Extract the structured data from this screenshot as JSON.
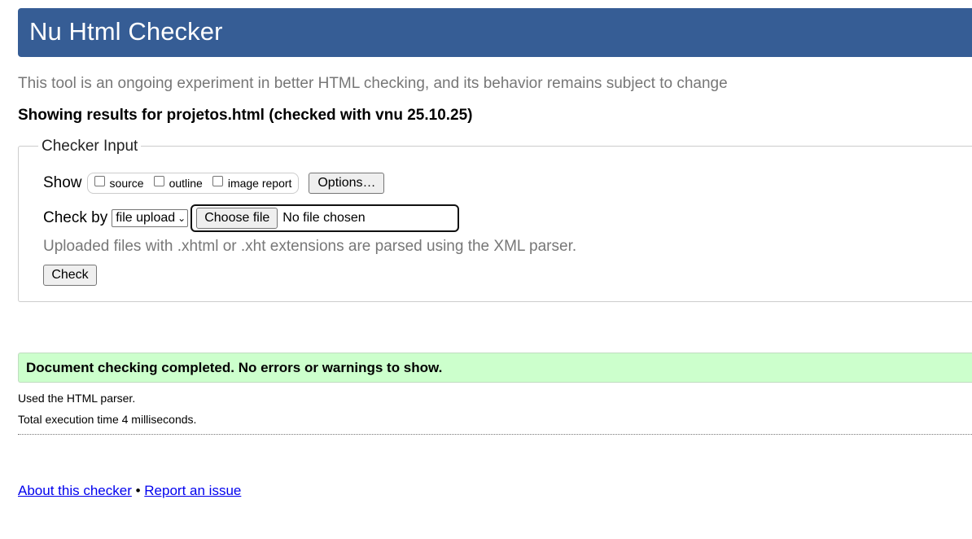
{
  "header": {
    "title": "Nu Html Checker"
  },
  "subtitle": "This tool is an ongoing experiment in better HTML checking, and its behavior remains subject to change",
  "results_heading": "Showing results for projetos.html (checked with vnu 25.10.25)",
  "checker_input": {
    "legend": "Checker Input",
    "show": {
      "label": "Show",
      "options": [
        {
          "label": "source",
          "checked": false
        },
        {
          "label": "outline",
          "checked": false
        },
        {
          "label": "image report",
          "checked": false
        }
      ],
      "options_button": "Options…"
    },
    "check_by": {
      "label": "Check by",
      "selected": "file upload",
      "choose_file_label": "Choose file",
      "file_status": "No file chosen"
    },
    "note": "Uploaded files with .xhtml or .xht extensions are parsed using the XML parser.",
    "check_button": "Check"
  },
  "result": {
    "message": "Document checking completed. No errors or warnings to show."
  },
  "details": {
    "parser": "Used the HTML parser.",
    "execution_time": "Total execution time 4 milliseconds."
  },
  "footer": {
    "about_link": "About this checker",
    "separator": "•",
    "report_link": "Report an issue"
  },
  "colors": {
    "header_bg": "#365d95",
    "success_bg": "#ccffcc",
    "muted_text": "#777777",
    "link": "#0000ee"
  }
}
